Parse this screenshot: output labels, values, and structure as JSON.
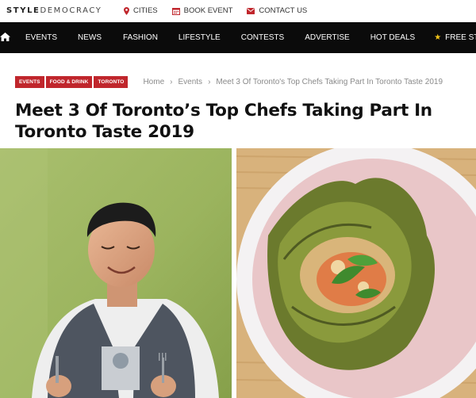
{
  "site": {
    "logo_bold": "STYLE",
    "logo_rest": "DEMOCRACY"
  },
  "utility": {
    "links": [
      {
        "label": "CITIES",
        "icon": "map-pin-icon"
      },
      {
        "label": "BOOK EVENT",
        "icon": "calendar-icon"
      },
      {
        "label": "CONTACT US",
        "icon": "envelope-icon"
      }
    ]
  },
  "nav": {
    "home_icon": "home-icon",
    "items": [
      "EVENTS",
      "NEWS",
      "FASHION",
      "LIFESTYLE",
      "CONTESTS",
      "ADVERTISE",
      "HOT DEALS",
      "FREE STUFF"
    ],
    "free_stuff_icon": "star-icon"
  },
  "article": {
    "tags": [
      "EVENTS",
      "FOOD & DRINK",
      "TORONTO"
    ],
    "breadcrumb": [
      "Home",
      "Events",
      "Meet 3 Of Toronto's Top Chefs Taking Part In Toronto Taste 2019"
    ],
    "headline_line1": "Meet 3 Of Toronto’s Top Chefs Taking Part In",
    "headline_line2": "Toronto Taste 2019"
  },
  "colors": {
    "accent": "#c0262c",
    "nav_bg": "#0b0b0b",
    "star": "#f5c518"
  }
}
